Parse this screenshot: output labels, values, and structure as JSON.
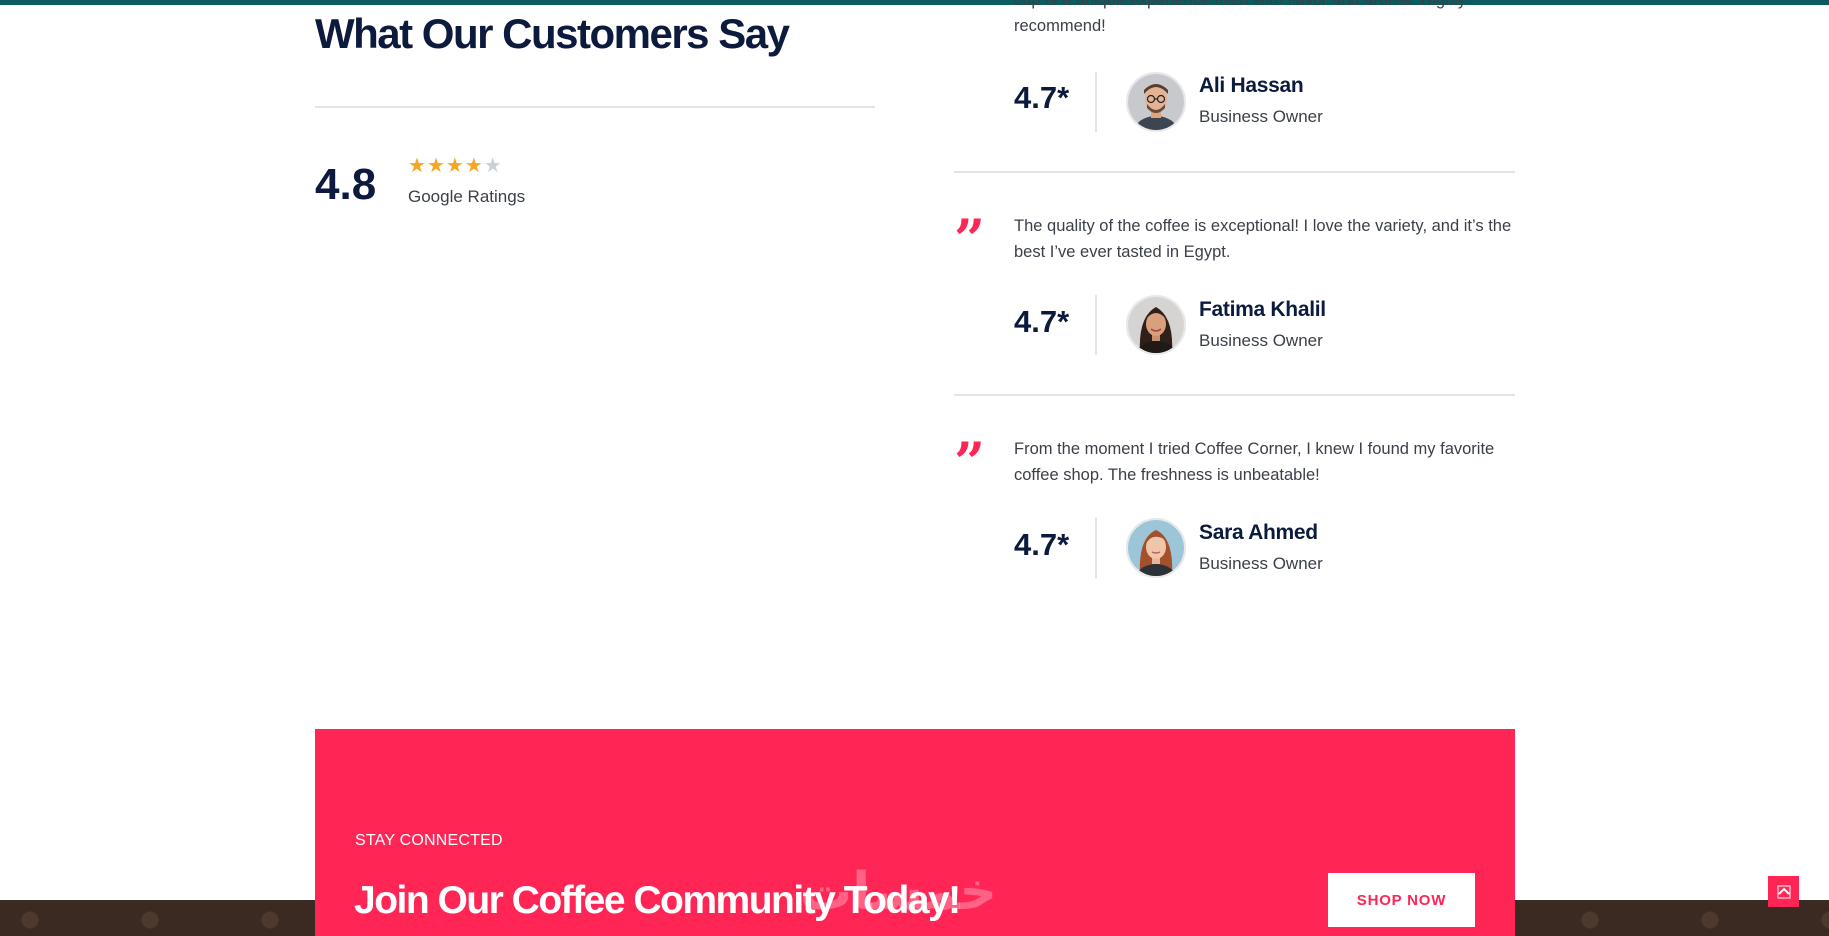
{
  "colors": {
    "accent": "#ff2656",
    "navy": "#0b1a3d",
    "teal_bar": "#0a5c5e",
    "star": "#f5a623"
  },
  "summary": {
    "title": "What Our Customers Say",
    "rating": "4.8",
    "stars_filled": 4,
    "stars_total": 5,
    "rating_source": "Google Ratings"
  },
  "testimonials": [
    {
      "quote": "cup is a unique experience filled with flavor and aroma. Highly recommend!",
      "rating": "4.7*",
      "name": "Ali Hassan",
      "role": "Business Owner",
      "avatar_icon": "avatar-man-glasses"
    },
    {
      "quote": "The quality of the coffee is exceptional! I love the variety, and it’s the best I’ve ever tasted in Egypt.",
      "rating": "4.7*",
      "name": "Fatima Khalil",
      "role": "Business Owner",
      "avatar_icon": "avatar-woman-dark-hair"
    },
    {
      "quote": "From the moment I tried Coffee Corner, I knew I found my favorite coffee shop. The freshness is unbeatable!",
      "rating": "4.7*",
      "name": "Sara Ahmed",
      "role": "Business Owner",
      "avatar_icon": "avatar-woman-red-hair"
    }
  ],
  "cta": {
    "eyebrow": "STAY CONNECTED",
    "title": "Join Our Coffee Community Today!",
    "button_label": "SHOP NOW"
  },
  "watermark": "خمسات",
  "scroll_top_icon": "chevron-up-icon"
}
